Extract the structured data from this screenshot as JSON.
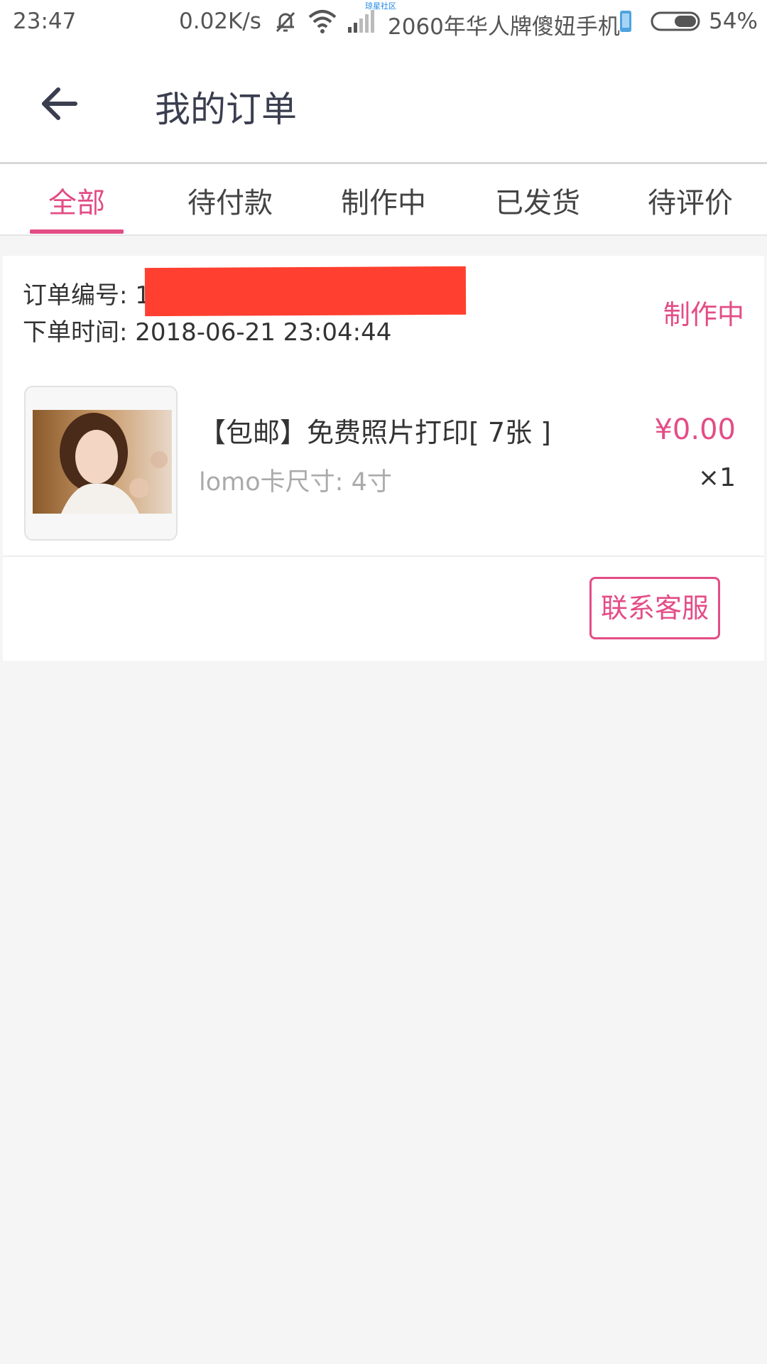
{
  "status_bar": {
    "time": "23:47",
    "net_speed": "0.02K/s",
    "watermark": "琼星社区",
    "carrier": "2060年华人牌傻妞手机",
    "battery": "54%",
    "icons": [
      "bell-off-icon",
      "wifi-icon",
      "signal-icon",
      "phone-icon",
      "battery-icon"
    ]
  },
  "header": {
    "title": "我的订单",
    "back_icon": "back-arrow-icon"
  },
  "tabs": [
    {
      "label": "全部",
      "active": true
    },
    {
      "label": "待付款",
      "active": false
    },
    {
      "label": "制作中",
      "active": false
    },
    {
      "label": "已发货",
      "active": false
    },
    {
      "label": "待评价",
      "active": false
    }
  ],
  "order": {
    "number_label": "订单编号: 1",
    "time_label": "下单时间: 2018-06-21 23:04:44",
    "status": "制作中",
    "product": {
      "name": "【包邮】免费照片打印[ 7张 ]",
      "spec": "lomo卡尺寸: 4寸",
      "price": "¥0.00",
      "quantity": "×1"
    },
    "contact_button": "联系客服"
  },
  "colors": {
    "accent": "#e34d86",
    "redaction": "#ff4030",
    "background": "#f5f5f5"
  }
}
